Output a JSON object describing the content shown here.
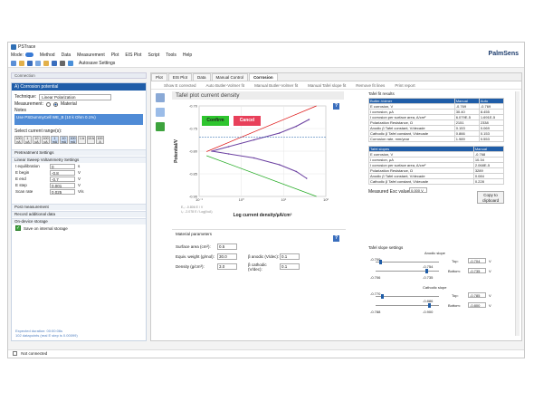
{
  "app": {
    "title": "PSTrace",
    "brand": "PalmSens"
  },
  "menu": {
    "mode_label": "Mode:",
    "items": [
      "Method",
      "Data",
      "Measurement",
      "Plot",
      "EIS Plot",
      "Script",
      "Tools",
      "Help"
    ]
  },
  "toolbar": {
    "new_label": "New",
    "autosave_label": "Autosave Settings"
  },
  "connection": {
    "label": "Connection"
  },
  "left": {
    "header": "A) Corrosion potential",
    "technique_label": "Technique:",
    "technique_value": "Linear Polarization",
    "measurement_label": "Measurement:",
    "material_label": "Material",
    "notes_label": "Notes",
    "notes_value": "Use PSDummyCell WE_B (10 k Ohm 0.1%)",
    "current_ranges_label": "Select current range(s):",
    "ranges": [
      "100 nA",
      "1 uA",
      "10 uA",
      "100 uA",
      "1 mA",
      "10 mA",
      "100 mA",
      "1 A",
      "10 A",
      "100 A"
    ],
    "sec_pretreatment": "Pretreatment Settings",
    "sec_lsv": "Linear Sweep Voltammetry Settings",
    "params": [
      {
        "label": "t equilibration",
        "value": "0",
        "unit": "s"
      },
      {
        "label": "E begin",
        "value": "-0.8",
        "unit": "V"
      },
      {
        "label": "E end",
        "value": "-0.7",
        "unit": "V"
      },
      {
        "label": "E step",
        "value": "0.001",
        "unit": "V"
      },
      {
        "label": "Scan rate",
        "value": "0.025",
        "unit": "V/s"
      }
    ],
    "sec_post": "Post measurement",
    "sec_record": "Record additional data",
    "sec_storage": "On-device storage",
    "save_label": "Save on internal storage",
    "expected_duration": "Expected duration: 00:00:06s",
    "datapoints": "102 datapoints (real E step is 0.00099)"
  },
  "status": {
    "text": "Not connected"
  },
  "tabs": [
    "Plot",
    "EIS Plot",
    "Data",
    "Manual Control",
    "Corrosion"
  ],
  "subtools": [
    "Show E corrected",
    "Auto Butler-Volmer fit",
    "Manual Butler-Volmer fit",
    "Manual Tafel slope fit",
    "Remove fit lines",
    "Print report"
  ],
  "plot": {
    "title": "Tafel plot current density",
    "confirm_label": "Confirm",
    "cancel_label": "Cancel",
    "fit_text": "E₀: -0.806 E / V\ni₀: -2.078 E / Log(i/uA)",
    "xlabel": "Log current density/µA/cm²",
    "ylabel": "Potential/V",
    "y_ticks": [
      "-0.70",
      "-0.75",
      "-0.80",
      "-0.85",
      "-0.90"
    ],
    "x_ticks": [
      "10⁻¹",
      "10⁰",
      "10¹",
      "10²"
    ]
  },
  "chart_data": {
    "type": "line",
    "title": "Tafel plot current density",
    "xlabel": "Log current density/µA/cm²",
    "ylabel": "Potential/V",
    "xlim": [
      0.1,
      100
    ],
    "ylim": [
      -0.9,
      -0.7
    ],
    "series": [
      {
        "name": "",
        "x": [
          35,
          20,
          8,
          2,
          0.5,
          0.2,
          0.5,
          2,
          8,
          20,
          40
        ],
        "y": [
          -0.86,
          -0.845,
          -0.83,
          -0.815,
          -0.806,
          -0.8,
          -0.79,
          -0.775,
          -0.76,
          -0.745,
          -0.73
        ]
      }
    ]
  },
  "material": {
    "title": "Material parameters",
    "rows": [
      {
        "l1": "Surface area (cm²):",
        "v1": "0.5",
        "l2": "",
        "v2": ""
      },
      {
        "l1": "Equiv. weight (g/mol):",
        "v1": "30.0",
        "l2": "β anodic (V/dec):",
        "v2": "0.1"
      },
      {
        "l1": "Density (g/cm³):",
        "v1": "3.0",
        "l2": "β cathodic (V/dec):",
        "v2": "0.1"
      }
    ]
  },
  "results": {
    "title": "Tafel fit results",
    "head": [
      "Butler-Volmer",
      "Manual",
      "Auto"
    ],
    "rows": [
      [
        "E corrosion, V",
        "-0.769",
        "-0.769"
      ],
      [
        "I corrosion, µA",
        "30.40",
        "8.455"
      ],
      [
        "I corrosion per surface area, A/cm²",
        "6.079E-5",
        "1.691E-5"
      ],
      [
        "Polarization Resistance, Ω",
        "2151",
        "2338"
      ],
      [
        "Anodic β Tafel constant, V/decade",
        "0.153",
        "0.069"
      ],
      [
        "Cathodic β Tafel constant, V/decade",
        "0.866",
        "0.153"
      ],
      [
        "Corrosion rate, mm/year",
        "1.989",
        "0.553"
      ]
    ],
    "head2": [
      "Tafel slopes",
      "Manual"
    ],
    "rows2": [
      [
        "E corrosion, V",
        "-0.768"
      ],
      [
        "I corrosion, µA",
        "10.34"
      ],
      [
        "I corrosion per surface area, A/cm²",
        "2.068E-5"
      ],
      [
        "Polarization Resistance, Ω",
        "3289"
      ],
      [
        "Anodic β Tafel constant, V/decade",
        "0.084"
      ],
      [
        "Cathodic β Tafel constant, V/decade",
        "0.228"
      ]
    ],
    "esc_label": "Measured Esc value:",
    "esc_value": "0.000 V",
    "copy_label": "Copy to clipboard"
  },
  "slopes": {
    "title": "Tafel slope settings",
    "anodic": "Anodic slope",
    "cathodic": "Cathodic slope",
    "top_label": "Top:",
    "bottom_label": "Bottom:",
    "a_top": "-0.704",
    "a_bottom": "-0.735",
    "c_top": "-0.785",
    "c_bottom": "-0.800",
    "a_l1": "-0.700",
    "a_l2": "-0.754",
    "a_l3": "-0.706",
    "a_l4": "-0.735",
    "c_l1": "-0.770",
    "c_l2": "-0.886",
    "c_l3": "-0.788",
    "c_l4": "-0.900",
    "unit": "V"
  }
}
